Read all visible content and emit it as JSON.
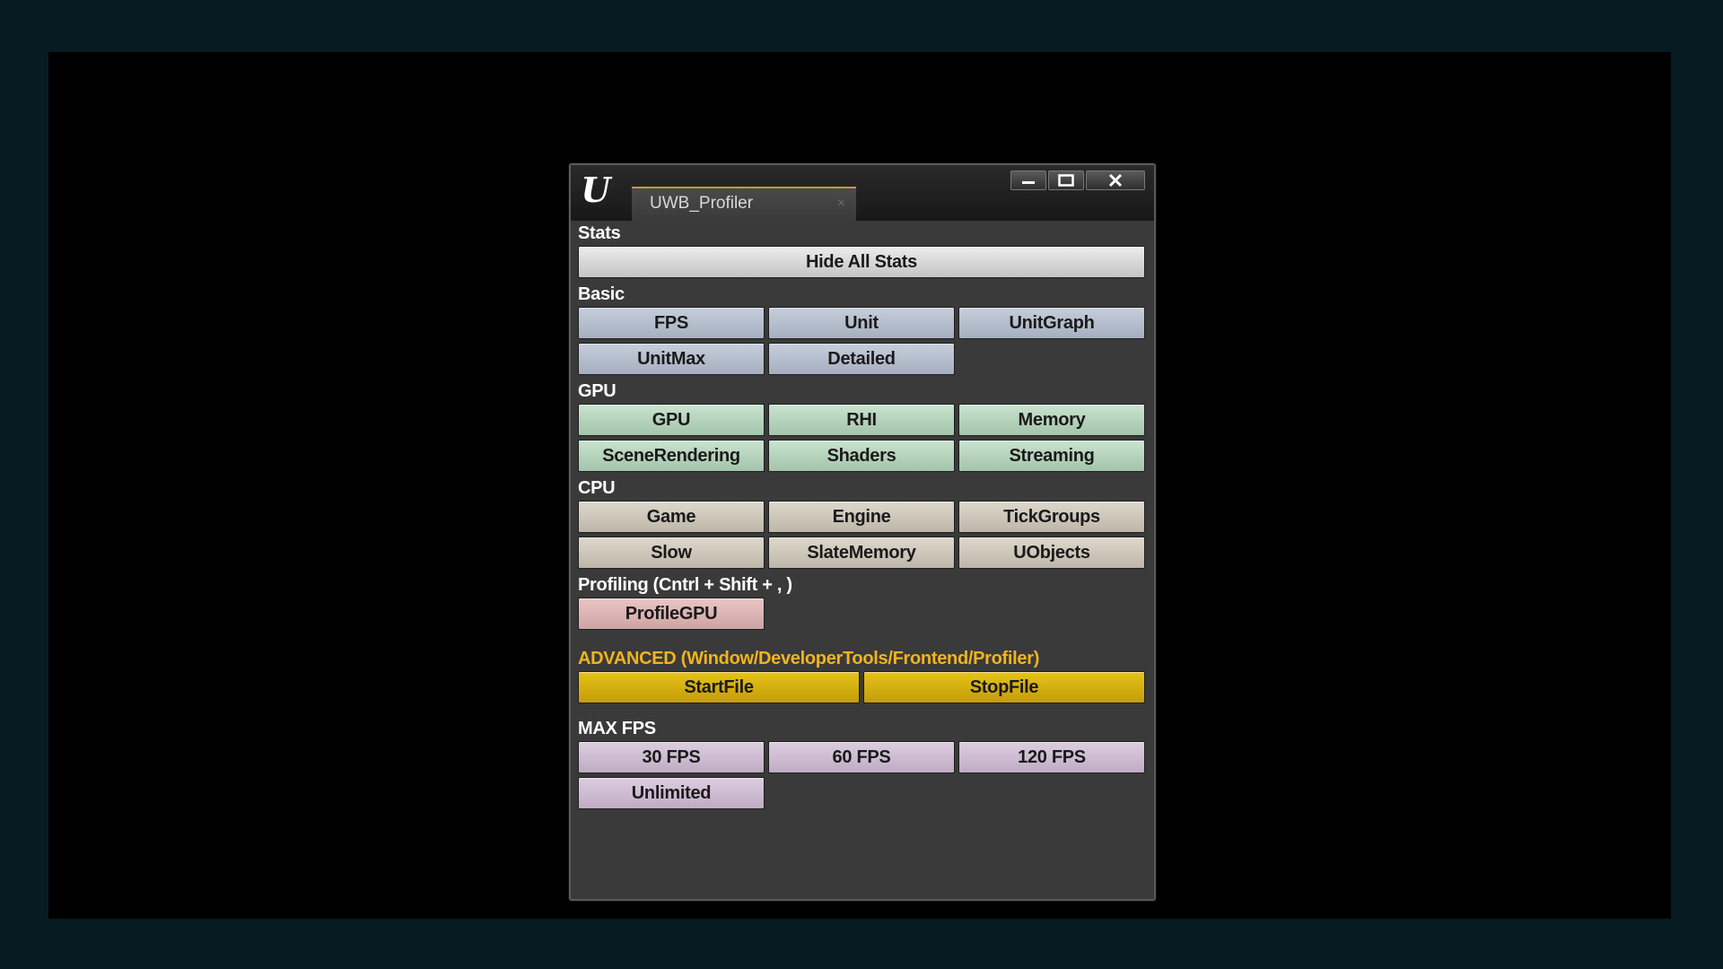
{
  "window": {
    "tab_title": "UWB_Profiler",
    "tab_close": "×",
    "logo": "U",
    "controls": {
      "minimize_icon": "minimize-icon",
      "maximize_icon": "maximize-icon",
      "close_icon": "close-icon"
    }
  },
  "sections": {
    "stats": {
      "label": "Stats",
      "hide_all": "Hide All Stats"
    },
    "basic": {
      "label": "Basic",
      "buttons": [
        "FPS",
        "Unit",
        "UnitGraph",
        "UnitMax",
        "Detailed"
      ]
    },
    "gpu": {
      "label": "GPU",
      "buttons": [
        "GPU",
        "RHI",
        "Memory",
        "SceneRendering",
        "Shaders",
        "Streaming"
      ]
    },
    "cpu": {
      "label": "CPU",
      "buttons": [
        "Game",
        "Engine",
        "TickGroups",
        "Slow",
        "SlateMemory",
        "UObjects"
      ]
    },
    "profiling": {
      "label": "Profiling (Cntrl + Shift + , )",
      "buttons": [
        "ProfileGPU"
      ]
    },
    "advanced": {
      "label": "ADVANCED (Window/DeveloperTools/Frontend/Profiler)",
      "buttons": [
        "StartFile",
        "StopFile"
      ]
    },
    "maxfps": {
      "label": "MAX FPS",
      "buttons": [
        "30 FPS",
        "60 FPS",
        "120 FPS",
        "Unlimited"
      ]
    }
  },
  "colors": {
    "background": "#061b22",
    "advanced_label": "#f2b31e",
    "tab_accent": "#c79a2c"
  }
}
